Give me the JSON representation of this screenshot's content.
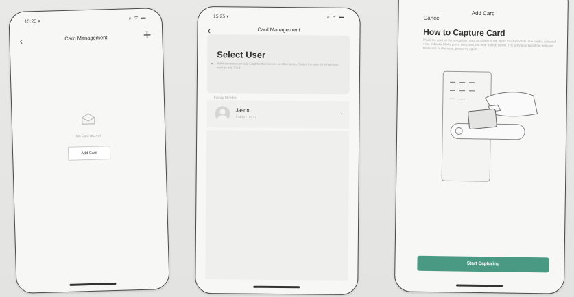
{
  "screen1": {
    "status_time": "15:23 ▾",
    "status_icons": "ᵢₗ ᯤ ▬",
    "nav_title": "Card Management",
    "add_icon": "+",
    "empty_text": "No Card records",
    "add_card_label": "Add Card"
  },
  "screen2": {
    "status_time": "15:25 ▾",
    "status_icons": "ᵢₗ ᯤ ▬",
    "nav_title": "Card Management",
    "select_title": "Select User",
    "select_desc": "Administrators can add Card for themselves or other users. Select the user for whom you want to add Card.",
    "group_label": "Family Member",
    "user": {
      "name": "Jason",
      "phone": "13435719777"
    }
  },
  "screen3": {
    "cancel_label": "Cancel",
    "nav_title": "Add Card",
    "how_title": "How to Capture Card",
    "how_desc": "Place the card on the recognition area as shown in the figure in 20 seconds. The card is activated if the indicator blinks green twice and you hear a beep sound. The activation fails if the indicator blinks red, in this case, please try again.",
    "start_label": "Start Capturing"
  },
  "colors": {
    "accent": "#4a9a83",
    "frame": "#4a4a4a",
    "background": "#e6e6e4"
  }
}
